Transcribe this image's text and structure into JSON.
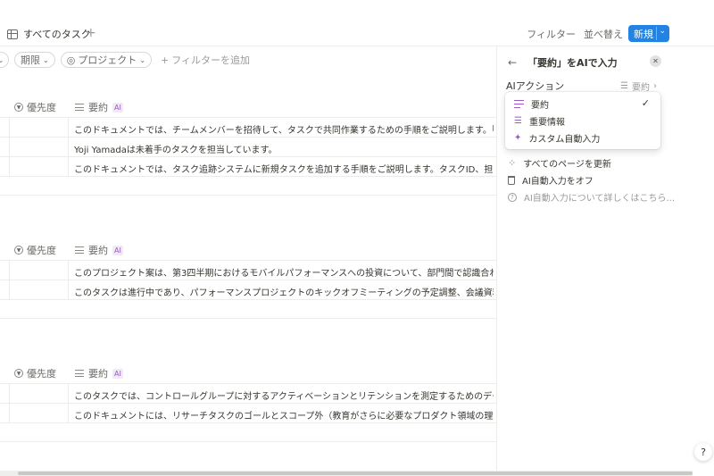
{
  "topbar": {
    "view_tab_label": "すべてのタスク",
    "add_view": "+",
    "filter_label": "フィルター",
    "sort_label": "並べ替え",
    "more_label": "•••",
    "new_label": "新規",
    "new_chevron": "⌄"
  },
  "filterbar": {
    "deadline_label": "期限",
    "project_label": "プロジェクト",
    "add_filter_label": "フィルターを追加"
  },
  "table": {
    "priority_header": "優先度",
    "summary_header": "要約",
    "ai_badge": "AI",
    "groups": [
      {
        "rows": [
          "このドキュメントでは、チームメンバーを招待して、タスクで共同作業するための手順をご説明します。「共有",
          "Yoji Yamadaは未着手のタスクを担当しています。",
          "このドキュメントでは、タスク追跡システムに新規タスクを追加する手順をご説明します。タスクID、担当者、ス"
        ]
      },
      {
        "rows": [
          "このプロジェクト案は、第3四半期におけるモバイルパフォーマンスへの投資について、部門間で認識合わせするこ",
          "このタスクは進行中であり、パフォーマンスプロジェクトのキックオフミーティングの予定調整、会議資料の事"
        ]
      },
      {
        "rows": [
          "このタスクでは、コントロールグループに対するアクティベーションとリテンションを測定するためのデータダッ",
          "このドキュメントには、リサーチタスクのゴールとスコープ外（教育がさらに必要なプロダクト領域の理解、エ"
        ]
      }
    ]
  },
  "panel": {
    "back": "←",
    "title": "「要約」をAIで入力",
    "close": "✕",
    "ai_action_label": "AIアクション",
    "ai_action_value": "要約",
    "ai_action_chevron": "›",
    "update_all": "すべてのページを更新",
    "turn_off": "AI自動入力をオフ",
    "learn_more": "AI自動入力について詳しくはこちら..."
  },
  "dropdown": {
    "items": [
      {
        "label": "要約",
        "selected": true,
        "check": "✓"
      },
      {
        "label": "重要情報",
        "selected": false
      },
      {
        "label": "カスタム自動入力",
        "selected": false
      }
    ]
  },
  "help_label": "?",
  "colors": {
    "accent": "#2383e2",
    "ai_purple": "#9a5bc4",
    "text": "#37352f",
    "muted": "#9b9a97"
  }
}
